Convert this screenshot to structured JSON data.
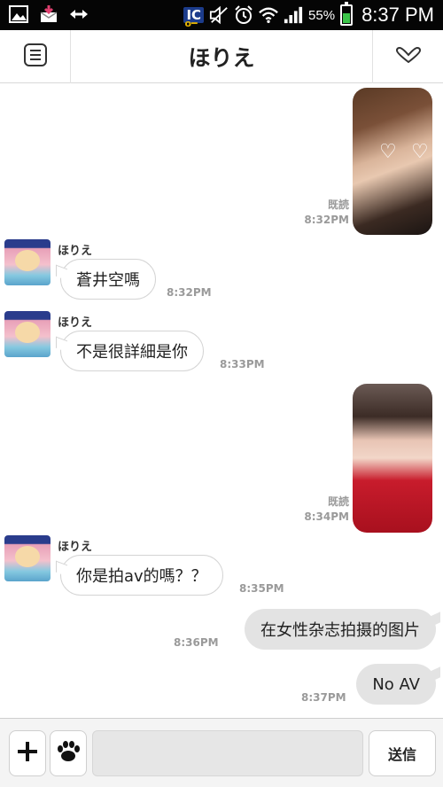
{
  "status_bar": {
    "icons": [
      "gallery-icon",
      "mail-download-icon",
      "transfer-icon",
      "ic-card-icon",
      "mute-icon",
      "alarm-icon",
      "wifi-icon",
      "signal-icon",
      "battery-icon"
    ],
    "ic_label": "IC",
    "battery": "55%",
    "time": "8:37 PM"
  },
  "header": {
    "title": "ほりえ",
    "menu_icon": "menu-list-icon",
    "dropdown_icon": "chevron-down-icon"
  },
  "messages": [
    {
      "type": "photo_out",
      "read_label": "既読",
      "time": "8:32PM"
    },
    {
      "type": "text_in",
      "sender": "ほりえ",
      "text": "蒼井空嗎",
      "time": "8:32PM"
    },
    {
      "type": "text_in",
      "sender": "ほりえ",
      "text": "不是很詳細是你",
      "time": "8:33PM"
    },
    {
      "type": "photo_out",
      "read_label": "既読",
      "time": "8:34PM"
    },
    {
      "type": "text_in",
      "sender": "ほりえ",
      "text": "你是拍av的嗎？？",
      "time": "8:35PM"
    },
    {
      "type": "text_out",
      "text": "在女性杂志拍摄的图片",
      "time": "8:36PM"
    },
    {
      "type": "text_out",
      "text": "No AV",
      "time": "8:37PM"
    }
  ],
  "input_bar": {
    "plus_icon": "plus-icon",
    "sticker_icon": "paw-icon",
    "input_value": "",
    "send_label": "送信"
  },
  "colors": {
    "status_bar_bg": "#050505",
    "outgoing_bubble": "#e3e3e3",
    "battery_green": "#3cc54a"
  }
}
